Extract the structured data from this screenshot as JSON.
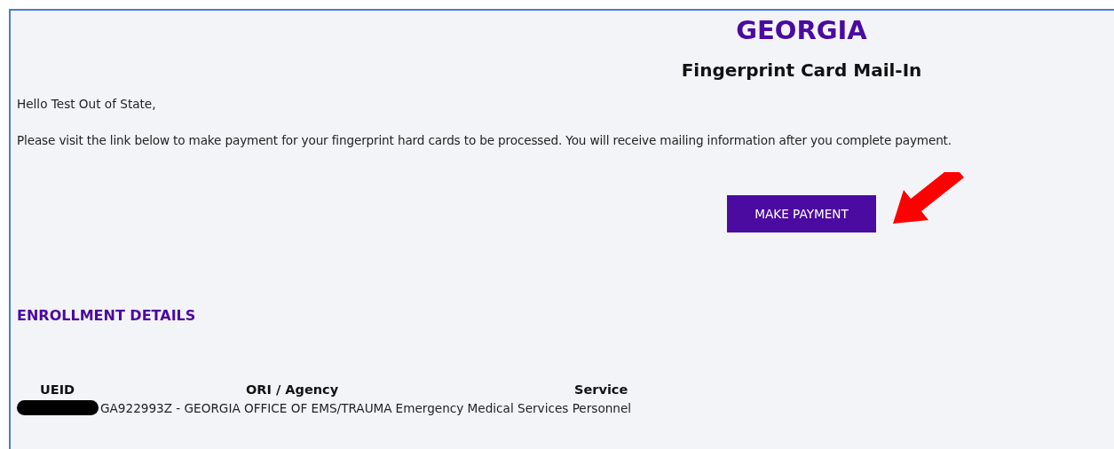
{
  "header": {
    "state": "GEORGIA",
    "title": "Fingerprint Card Mail-In"
  },
  "greeting": "Hello Test Out of State,",
  "message": "Please visit the link below to make payment for your fingerprint hard cards to be processed. You will receive mailing information after you complete payment.",
  "payment_button": "MAKE PAYMENT",
  "enrollment": {
    "heading": "ENROLLMENT DETAILS",
    "columns": [
      "UEID",
      "ORI / Agency",
      "Service"
    ],
    "rows": [
      {
        "ueid_redacted": true,
        "agency": "GA922993Z - GEORGIA OFFICE OF EMS/TRAUMA",
        "service": "Emergency Medical Services Personnel"
      }
    ]
  }
}
